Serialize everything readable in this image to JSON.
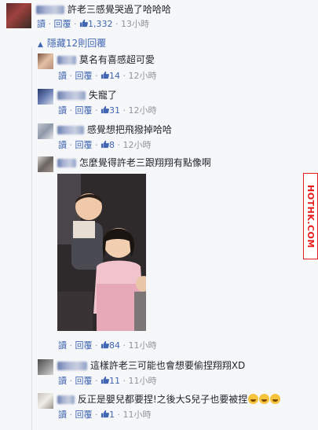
{
  "actions": {
    "reply": "讀 · 回覆 · ",
    "dot": " · "
  },
  "top_comment": {
    "text": "許老三感覺哭過了哈哈哈",
    "likes": "1,332",
    "time": "13小時"
  },
  "hidden_replies": "隱藏12則回覆",
  "replies": [
    {
      "text": "莫名有喜感超可愛",
      "likes": "14",
      "time": "12小時"
    },
    {
      "text": "失寵了",
      "likes": "31",
      "time": "12小時"
    },
    {
      "text": "感覺想把飛撥掉哈哈",
      "likes": "8",
      "time": "12小時"
    },
    {
      "text": "怎麼覺得許老三跟翔翔有點像啊",
      "likes": "84",
      "time": "11小時"
    },
    {
      "text": "這樣許老三可能也會想要偷捏翔翔XD",
      "likes": "11",
      "time": "11小時"
    },
    {
      "text": "反正是嬰兒都要捏!之後大S兒子也要被捏",
      "likes": "1",
      "time": "11小時"
    }
  ],
  "labels": {
    "read": "讀",
    "reply": "回覆"
  },
  "watermark": "HOTHK.COM",
  "colors": {
    "link": "#4267b2",
    "watermark": "#e61e1e"
  },
  "icons": [
    "like-icon",
    "laughing-emoji-icon"
  ]
}
